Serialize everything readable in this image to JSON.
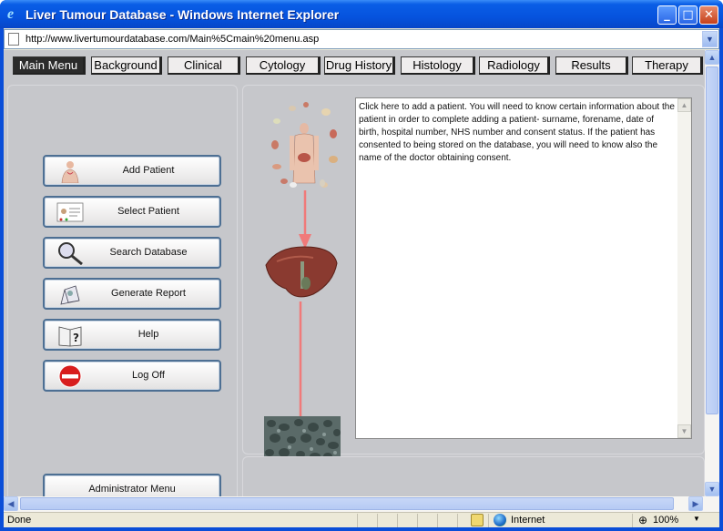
{
  "window": {
    "title": "Liver Tumour Database - Windows Internet Explorer",
    "minimize": "_",
    "maximize": "□",
    "close": "✕"
  },
  "address": {
    "url": "http://www.livertumourdatabase.com/Main%5Cmain%20menu.asp"
  },
  "tabs": [
    {
      "label": "Main Menu",
      "active": true
    },
    {
      "label": "Background"
    },
    {
      "label": "Clinical"
    },
    {
      "label": "Cytology"
    },
    {
      "label": "Drug History"
    },
    {
      "label": "Histology"
    },
    {
      "label": "Radiology"
    },
    {
      "label": "Results"
    },
    {
      "label": "Therapy"
    }
  ],
  "menu_buttons": [
    {
      "label": "Add Patient",
      "icon": "body-icon"
    },
    {
      "label": "Select Patient",
      "icon": "patient-card-icon"
    },
    {
      "label": "Search Database",
      "icon": "magnifier-icon"
    },
    {
      "label": "Generate Report",
      "icon": "report-icon"
    },
    {
      "label": "Help",
      "icon": "help-book-icon"
    },
    {
      "label": "Log Off",
      "icon": "no-entry-icon"
    }
  ],
  "admin_button": {
    "label": "Administrator Menu"
  },
  "info_text": "Click here to add a patient. You will need to know certain information about the patient in order to complete adding a patient- surname, forename, date of birth, hospital number, NHS number and consent status. If the patient has consented to being stored on the database, you will need to know also the name of the doctor obtaining consent.",
  "status": {
    "left": "Done",
    "zone": "Internet",
    "zoom": "100%"
  },
  "colors": {
    "title_blue": "#0653de",
    "page_grey": "#c6c7cb",
    "arrow_red": "#f07a7a",
    "active_tab": "#2b2b2b"
  }
}
